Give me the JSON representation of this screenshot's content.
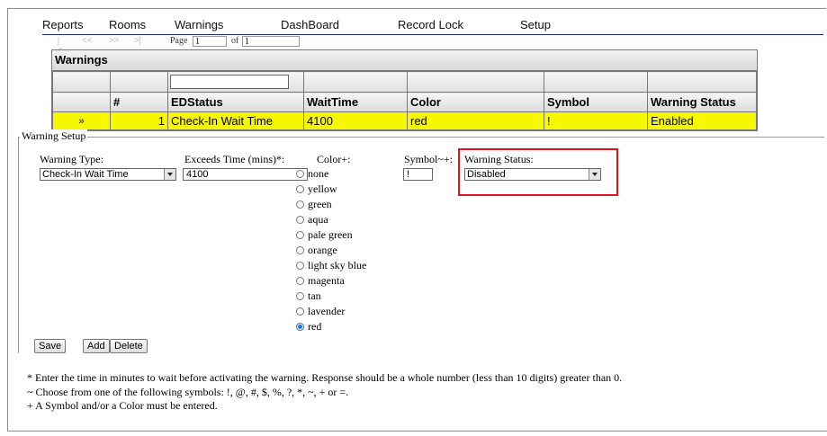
{
  "menu": [
    "Reports",
    "Rooms",
    "Warnings",
    "DashBoard",
    "Record Lock",
    "Setup"
  ],
  "pager": {
    "first": "|<",
    "prev": "<<",
    "next": ">>",
    "last": ">|",
    "page_label": "Page",
    "page_value": "1",
    "of_label": "of",
    "of_value": "1"
  },
  "grid": {
    "caption": "Warnings",
    "headers": [
      "",
      "#",
      "EDStatus",
      "WaitTime",
      "Color",
      "Symbol",
      "Warning Status"
    ],
    "rows": [
      {
        "marker": "»",
        "num": "1",
        "edstatus": "Check-In Wait Time",
        "waittime": "4100",
        "color": "red",
        "symbol": "!",
        "status": "Enabled"
      }
    ]
  },
  "setup": {
    "legend": "Warning Setup",
    "warning_type": {
      "label": "Warning Type:",
      "value": "Check-In Wait Time"
    },
    "exceeds_time": {
      "label": "Exceeds Time (mins)*:",
      "value": "4100"
    },
    "color": {
      "label": "Color+:",
      "options": [
        "none",
        "yellow",
        "green",
        "aqua",
        "pale green",
        "orange",
        "light sky blue",
        "magenta",
        "tan",
        "lavender",
        "red"
      ],
      "selected": "red"
    },
    "symbol": {
      "label": "Symbol~+:",
      "value": "!"
    },
    "warning_status": {
      "label": "Warning Status:",
      "value": "Disabled"
    },
    "buttons": {
      "save": "Save",
      "add": "Add",
      "delete": "Delete"
    },
    "notes": [
      "* Enter the time in minutes to wait before activating the warning. Response should be a whole number (less than 10 digits) greater than 0.",
      "~ Choose from one of the following symbols: !, @, #, $, %, ?, *, ~, + or =.",
      "+ A Symbol and/or a Color must be entered."
    ]
  },
  "colors": {
    "row_highlight": "#f7f700",
    "annotation": "#e0141e",
    "menu_rule": "#1d2a86"
  }
}
